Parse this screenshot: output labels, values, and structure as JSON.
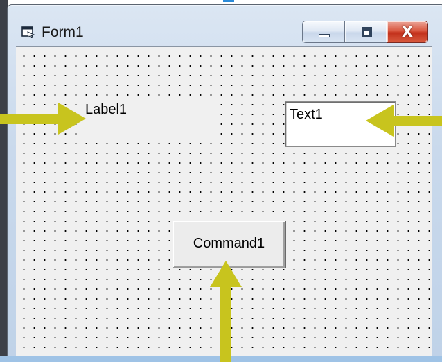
{
  "window": {
    "title": "Form1",
    "icon": "form-window-icon",
    "controls": {
      "minimize_icon": "minimize-icon",
      "maximize_icon": "maximize-icon",
      "close_label": "X"
    }
  },
  "form": {
    "label": {
      "text": "Label1"
    },
    "textbox": {
      "value": "Text1"
    },
    "command_button": {
      "label": "Command1"
    }
  },
  "annotations": {
    "arrow_color": "#c8c41e",
    "arrows": [
      "arrow-to-label",
      "arrow-to-textbox",
      "arrow-to-command-button"
    ]
  },
  "colors": {
    "client_background": "#f0f0f0",
    "grid_dots": "#000000",
    "close_button": "#c2301b",
    "frame": "#c9d9ec"
  }
}
